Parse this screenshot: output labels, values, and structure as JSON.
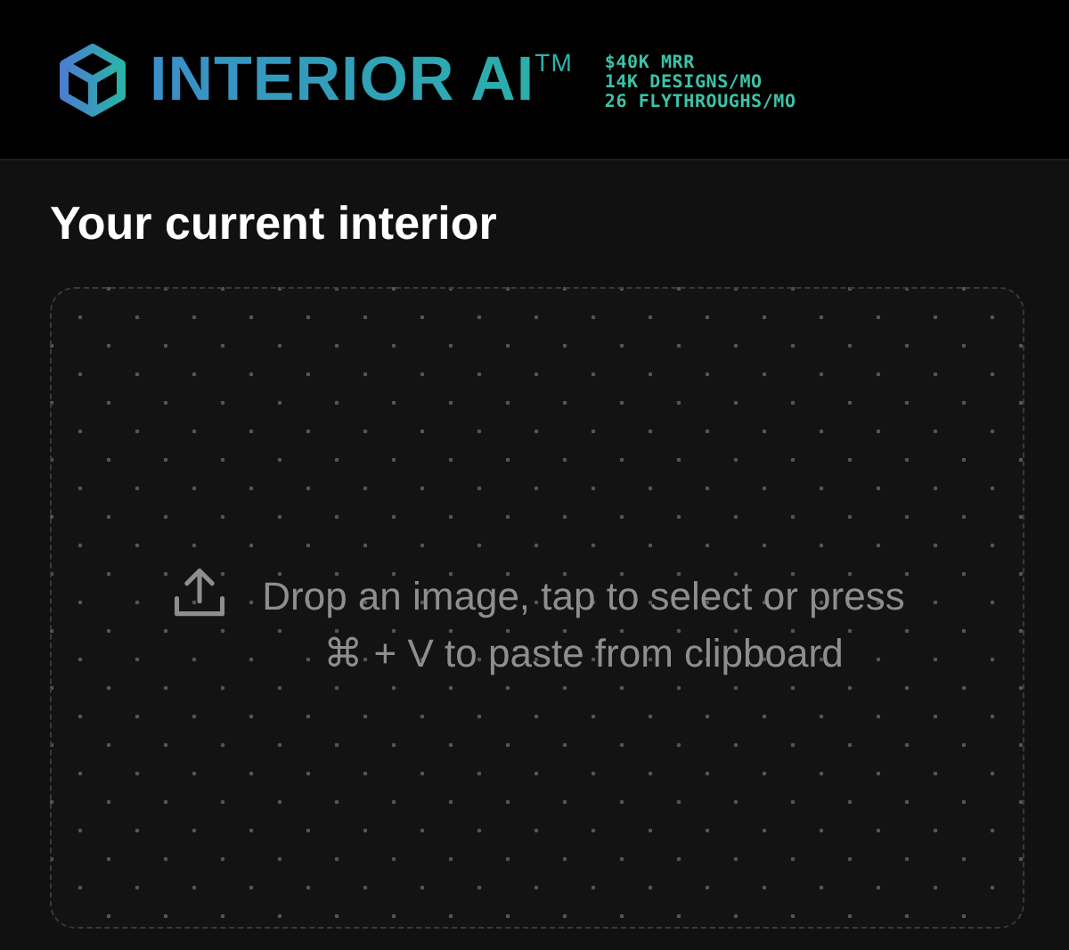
{
  "header": {
    "brand": "INTERIOR AI$^{TM}$",
    "stats": [
      "$40K MRR",
      "14K DESIGNS/MO",
      "26 FLYTHROUGHS/MO"
    ]
  },
  "section": {
    "title": "Your current interior"
  },
  "dropzone": {
    "lines": [
      "Drop an image, tap to select or press",
      "⌘ + V to paste from clipboard"
    ]
  }
}
